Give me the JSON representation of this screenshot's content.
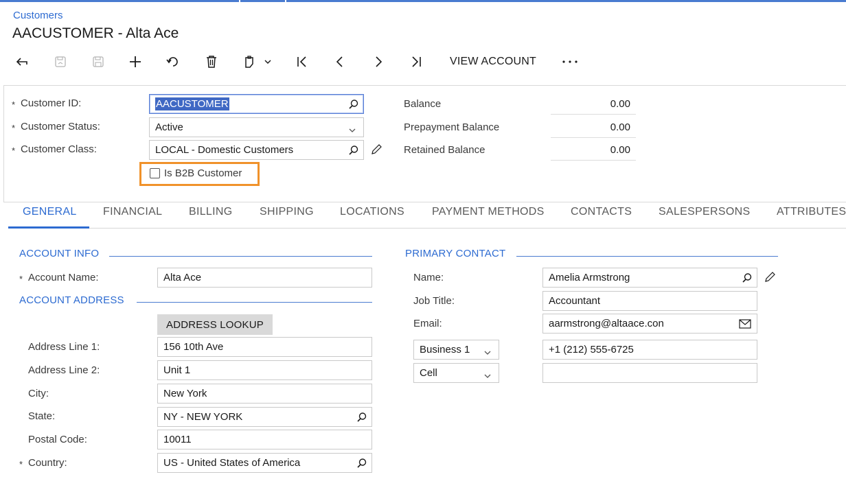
{
  "breadcrumb": "Customers",
  "title": "AACUSTOMER - Alta Ace",
  "toolbar": {
    "back": "arrow-back-icon",
    "save_close": "save-close-icon",
    "save": "save-icon",
    "add": "plus-icon",
    "undo": "undo-icon",
    "delete": "trash-icon",
    "copy_paste": "clipboard-icon",
    "first": "first-record-icon",
    "previous": "previous-record-icon",
    "next": "next-record-icon",
    "last": "last-record-icon",
    "view_account_label": "VIEW ACCOUNT",
    "more": "more-icon"
  },
  "header": {
    "customer_id_label": "Customer ID:",
    "customer_id_value": "AACUSTOMER",
    "customer_status_label": "Customer Status:",
    "customer_status_value": "Active",
    "customer_class_label": "Customer Class:",
    "customer_class_value": "LOCAL - Domestic Customers",
    "is_b2b_label": "Is B2B Customer",
    "is_b2b_checked": false,
    "balance_label": "Balance",
    "balance_value": "0.00",
    "prepayment_label": "Prepayment Balance",
    "prepayment_value": "0.00",
    "retained_label": "Retained Balance",
    "retained_value": "0.00",
    "required_marker": "*"
  },
  "tabs": [
    "GENERAL",
    "FINANCIAL",
    "BILLING",
    "SHIPPING",
    "LOCATIONS",
    "PAYMENT METHODS",
    "CONTACTS",
    "SALESPERSONS",
    "ATTRIBUTES"
  ],
  "active_tab": "GENERAL",
  "account_info": {
    "section_title": "ACCOUNT INFO",
    "account_name_label": "Account Name:",
    "account_name_value": "Alta Ace"
  },
  "account_address": {
    "section_title": "ACCOUNT ADDRESS",
    "lookup_button": "ADDRESS LOOKUP",
    "line1_label": "Address Line 1:",
    "line1_value": "156 10th Ave",
    "line2_label": "Address Line 2:",
    "line2_value": "Unit 1",
    "city_label": "City:",
    "city_value": "New York",
    "state_label": "State:",
    "state_value": "NY - NEW YORK",
    "postal_label": "Postal Code:",
    "postal_value": "10011",
    "country_label": "Country:",
    "country_value": "US - United States of America"
  },
  "primary_contact": {
    "section_title": "PRIMARY CONTACT",
    "name_label": "Name:",
    "name_value": "Amelia Armstrong",
    "job_title_label": "Job Title:",
    "job_title_value": "Accountant",
    "email_label": "Email:",
    "email_value": "aarmstrong@altaace.con",
    "phone1_type": "Business 1",
    "phone1_value": "+1 (212) 555-6725",
    "phone2_type": "Cell",
    "phone2_value": ""
  },
  "colors": {
    "accent": "#2d6bd1",
    "highlight_box": "#f0922a",
    "selection": "#3f68c4"
  }
}
